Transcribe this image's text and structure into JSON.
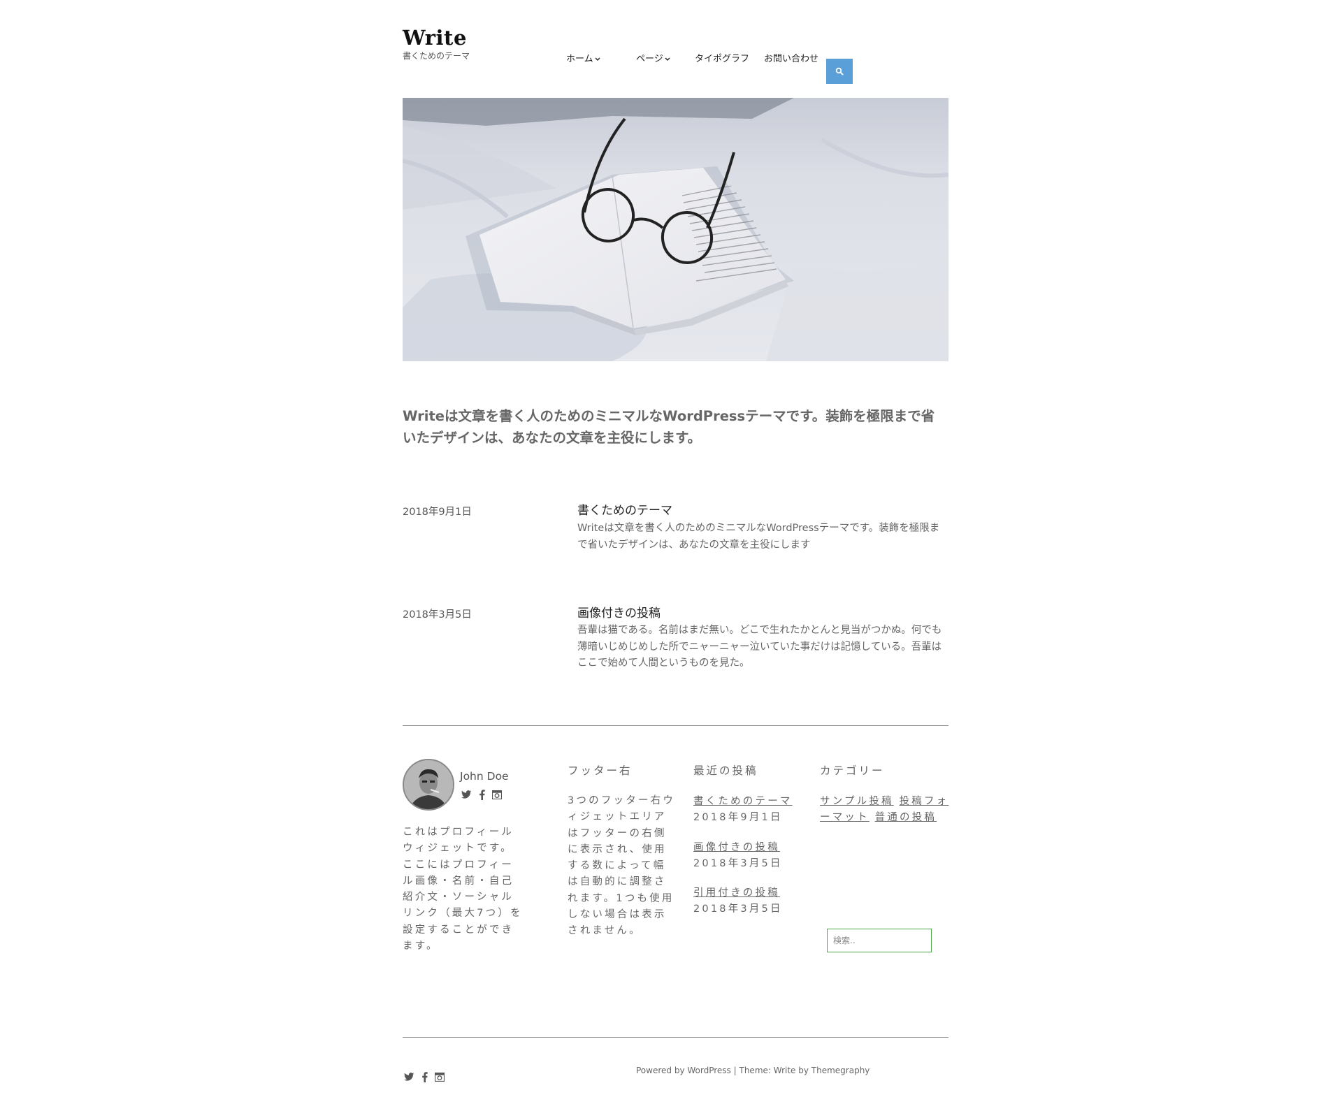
{
  "site": {
    "title": "Write",
    "tagline": "書くためのテーマ"
  },
  "nav": {
    "items": [
      {
        "label": "ホーム",
        "has_dropdown": true
      },
      {
        "label": "ページ",
        "has_dropdown": true
      },
      {
        "label": "タイポグラフ",
        "has_dropdown": false
      },
      {
        "label": "お問い合わせ",
        "has_dropdown": false
      }
    ],
    "search_icon": "search-icon",
    "accent_color": "#5a9fd8"
  },
  "intro": "Writeは文章を書く人のためのミニマルなWordPressテーマです。装飾を極限まで省いたデザインは、あなたの文章を主役にします。",
  "posts": [
    {
      "date": "2018年9月1日",
      "title": "書くためのテーマ",
      "excerpt": "Writeは文章を書く人のためのミニマルなWordPressテーマです。装飾を極限まで省いたデザインは、あなたの文章を主役にします"
    },
    {
      "date": "2018年3月5日",
      "title": "画像付きの投稿",
      "excerpt": "吾輩は猫である。名前はまだ無い。どこで生れたかとんと見当がつかぬ。何でも薄暗いじめじめした所でニャーニャー泣いていた事だけは記憶している。吾輩はここで始めて人間というものを見た。"
    }
  ],
  "footer": {
    "profile": {
      "name": "John Doe",
      "bio": "これはプロフィールウィジェットです。ここにはプロフィール画像・名前・自己紹介文・ソーシャルリンク（最大7つ）を設定することができます。",
      "social_icons": [
        "twitter-icon",
        "facebook-icon",
        "instagram-icon"
      ]
    },
    "right_widget": {
      "title": "フッター右",
      "text": "3つのフッター右ウィジェットエリアはフッターの右側に表示され、使用する数によって幅は自動的に調整されます。1つも使用しない場合は表示されません。"
    },
    "recent_posts": {
      "title": "最近の投稿",
      "items": [
        {
          "title": "書くためのテーマ",
          "date": "2018年9月1日"
        },
        {
          "title": "画像付きの投稿",
          "date": "2018年3月5日"
        },
        {
          "title": "引用付きの投稿",
          "date": "2018年3月5日"
        }
      ]
    },
    "categories": {
      "title": "カテゴリー",
      "items": [
        "サンプル投稿",
        "投稿フォーマット",
        "普通の投稿"
      ]
    },
    "search_placeholder": "検索.."
  },
  "bottom": {
    "social_icons": [
      "twitter-icon",
      "facebook-icon",
      "instagram-icon"
    ],
    "powered_by": "Powered by WordPress",
    "separator": "|",
    "theme_credit": "Theme: Write by Themegraphy"
  }
}
